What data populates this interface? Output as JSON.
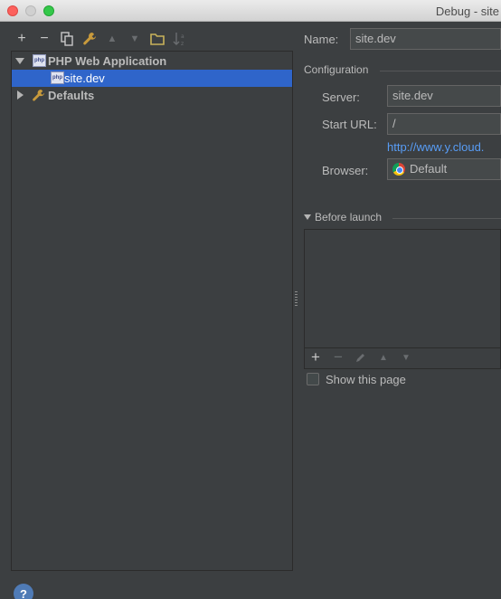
{
  "window": {
    "title": "Debug - site"
  },
  "toolbar": {
    "add_icon": "+",
    "remove_icon": "−",
    "copy_icon": "copy-icon",
    "edit_defaults_icon": "wrench-icon",
    "move_up_icon": "▲",
    "move_down_icon": "▼",
    "folder_icon": "folder-icon",
    "sort_icon": "sort-az-icon"
  },
  "tree": {
    "items": [
      {
        "label": "PHP Web Application",
        "expanded": true,
        "icon": "php-icon"
      },
      {
        "label": "site.dev",
        "selected": true,
        "icon": "php-icon"
      },
      {
        "label": "Defaults",
        "expanded": false,
        "icon": "wrench-icon"
      }
    ]
  },
  "form": {
    "name_label": "Name:",
    "name_value": "site.dev",
    "configuration_title": "Configuration",
    "server_label": "Server:",
    "server_value": "site.dev",
    "start_url_label": "Start URL:",
    "start_url_value": "/",
    "url_link": "http://www.y.cloud.",
    "browser_label": "Browser:",
    "browser_value": "Default"
  },
  "before_launch": {
    "title": "Before launch",
    "show_page_label": "Show this page",
    "show_page_checked": false
  },
  "help": {
    "label": "?"
  }
}
